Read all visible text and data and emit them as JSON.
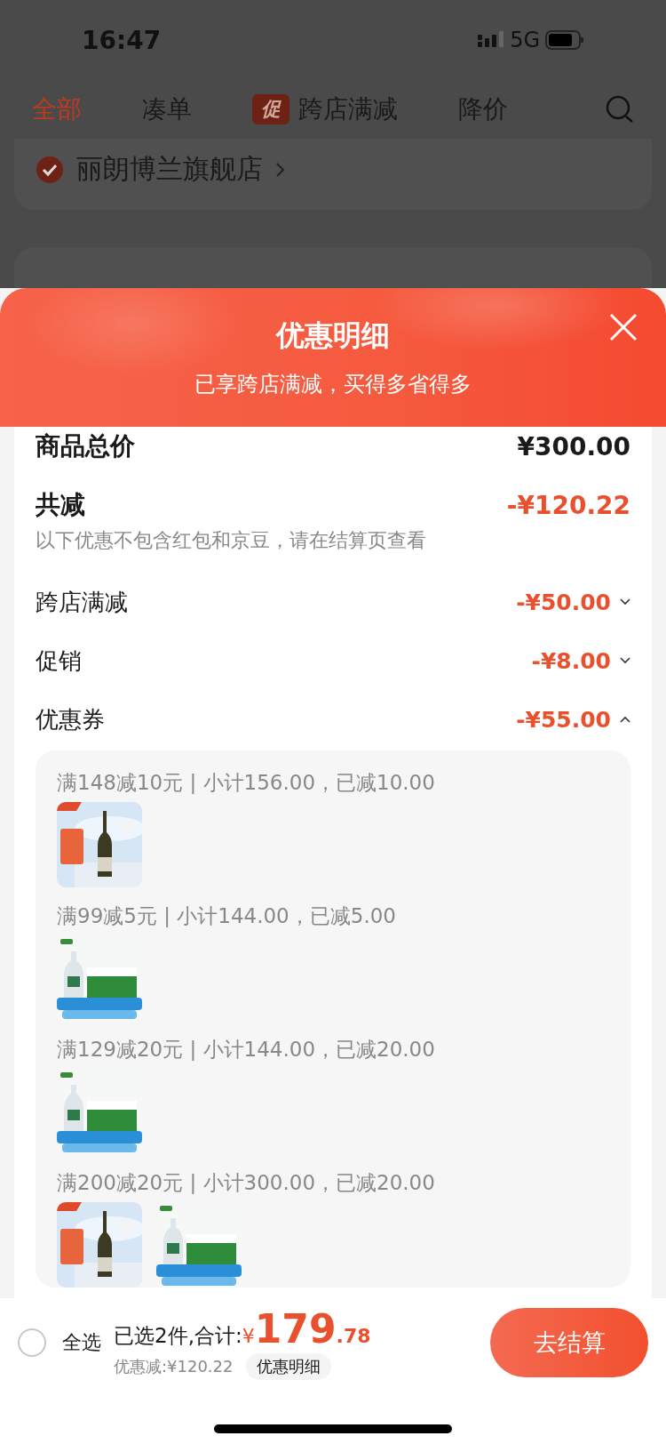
{
  "status_bar": {
    "time": "16:47",
    "network": "5G"
  },
  "tabs": [
    {
      "label": "全部",
      "selected": true
    },
    {
      "label": "凑单",
      "selected": false
    },
    {
      "label": "跨店满减",
      "selected": false,
      "badge": "促"
    },
    {
      "label": "降价",
      "selected": false
    }
  ],
  "store": {
    "name": "丽朗博兰旗舰店",
    "checked": true
  },
  "sheet": {
    "title": "优惠明细",
    "subtitle": "已享跨店满减，买得多省得多",
    "total": {
      "label": "商品总价",
      "value": "¥300.00"
    },
    "discount": {
      "label": "共减",
      "value": "-¥120.22",
      "note": "以下优惠不包含红包和京豆，请在结算页查看"
    },
    "items": [
      {
        "label": "跨店满减",
        "value": "-¥50.00",
        "expanded": false
      },
      {
        "label": "促销",
        "value": "-¥8.00",
        "expanded": false
      },
      {
        "label": "优惠券",
        "value": "-¥55.00",
        "expanded": true,
        "groups": [
          {
            "text": "满148减10元 | 小计156.00，已减10.00"
          },
          {
            "text": "满99减5元 | 小计144.00，已减5.00"
          },
          {
            "text": "满129减20元 | 小计144.00，已减20.00"
          },
          {
            "text": "满200减20元 | 小计300.00，已减20.00"
          }
        ]
      }
    ]
  },
  "bottom_bar": {
    "select_all": {
      "label": "全选",
      "checked": false
    },
    "summary": "已选2件,合计:",
    "currency": "¥",
    "price_int": "179",
    "price_dec": ".78",
    "saving": "优惠减:¥120.22",
    "detail_button": "优惠明细",
    "checkout_button": "去结算"
  }
}
